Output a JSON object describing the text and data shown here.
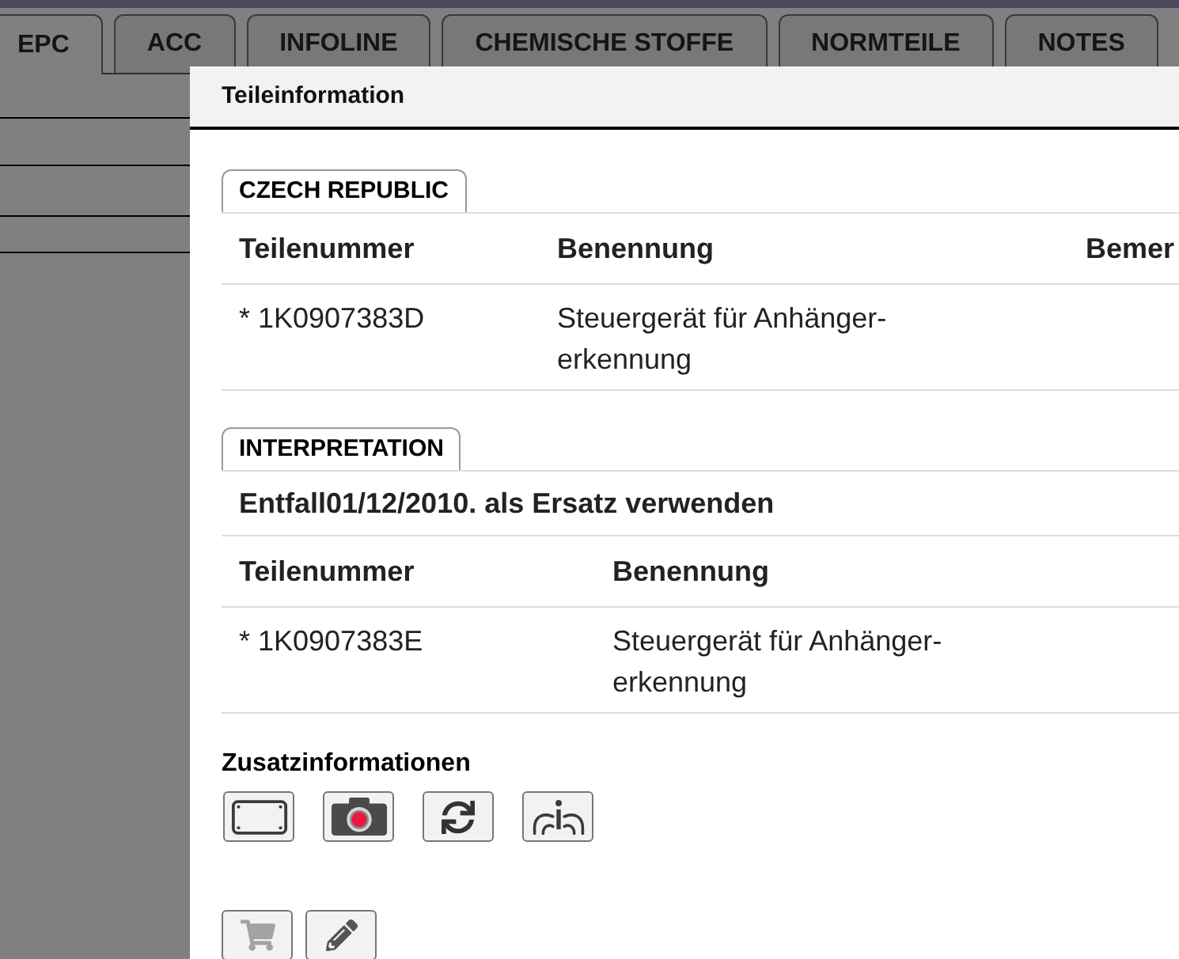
{
  "tabs": [
    {
      "label": "EPC",
      "selected": true
    },
    {
      "label": "ACC",
      "selected": false
    },
    {
      "label": "INFOLINE",
      "selected": false
    },
    {
      "label": "CHEMISCHE STOFFE",
      "selected": false
    },
    {
      "label": "NORMTEILE",
      "selected": false
    },
    {
      "label": "NOTES",
      "selected": false
    }
  ],
  "dialog": {
    "title": "Teileinformation",
    "sections": [
      {
        "label": "CZECH REPUBLIC",
        "table": {
          "columns": [
            "Teilenummer",
            "Benennung",
            "Bemer"
          ],
          "rows": [
            [
              "* 1K0907383D",
              "Steuergerät für Anhänger-erkennung"
            ]
          ]
        }
      },
      {
        "label": "INTERPRETATION",
        "note": "Entfall01/12/2010. als Ersatz verwenden",
        "table": {
          "columns": [
            "Teilenummer",
            "Benennung"
          ],
          "rows": [
            [
              "* 1K0907383E",
              "Steuergerät für Anhänger-erkennung"
            ]
          ]
        }
      }
    ],
    "extra_info": {
      "title": "Zusatzinformationen",
      "buttons": [
        {
          "kind": "frame"
        },
        {
          "kind": "camera"
        },
        {
          "kind": "refresh"
        },
        {
          "kind": "info"
        }
      ]
    },
    "actions": [
      {
        "kind": "cart",
        "disabled": true
      },
      {
        "kind": "pencil",
        "disabled": false
      }
    ]
  }
}
